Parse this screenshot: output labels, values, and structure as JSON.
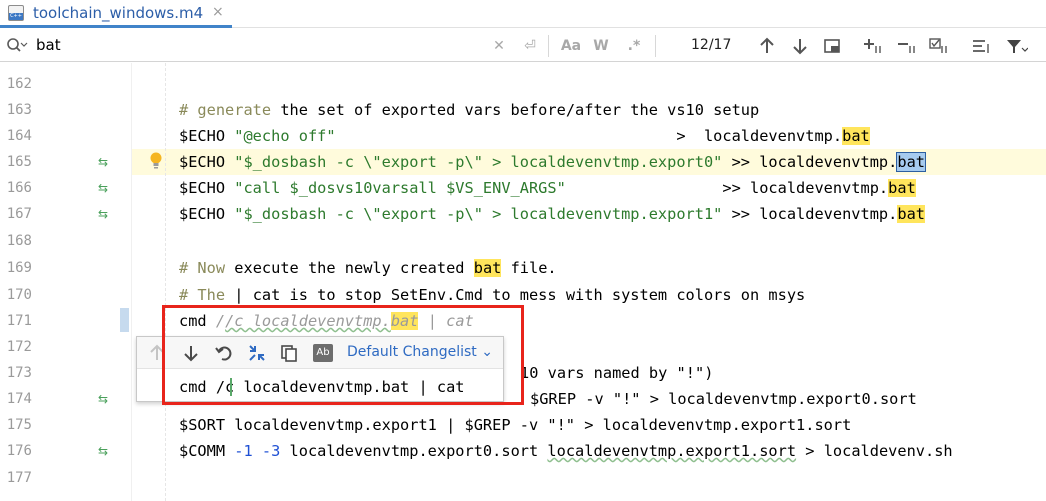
{
  "tab": {
    "title": "toolchain_windows.m4",
    "icon_label": "C++",
    "close": "×"
  },
  "search": {
    "value": "bat",
    "match_count": "12/17",
    "icons": {
      "case_label": "Aa",
      "word_label": "W",
      "regex_label": ".*"
    }
  },
  "editor": {
    "line_numbers": [
      "162",
      "163",
      "164",
      "165",
      "166",
      "167",
      "168",
      "169",
      "170",
      "171",
      "172",
      "173",
      "174",
      "175",
      "176",
      "177"
    ],
    "lines": {
      "l163_comment": "# generate",
      "l163_rest": " the set of exported vars before/after the vs10 setup",
      "l164_a": "$ECHO ",
      "l164_str": "\"@echo off\"",
      "l164_b": "                                     >  localdevenvtmp.",
      "l165_a": "$ECHO ",
      "l165_str": "\"$_dosbash -c \\\"export -p\\\" > localdevenvtmp.export0\"",
      "l165_b": " >> localdevenvtmp.",
      "l166_a": "$ECHO ",
      "l166_str": "\"call $_dosvs10varsall $VS_ENV_ARGS\"",
      "l166_b": "                 >> localdevenvtmp.",
      "l167_a": "$ECHO ",
      "l167_str": "\"$_dosbash -c \\\"export -p\\\" > localdevenvtmp.export1\"",
      "l167_b": " >> localdevenvtmp.",
      "match": "bat",
      "l169_comment": "# Now",
      "l169_a": " execute the newly created ",
      "l169_b": " file.",
      "l170_comment": "# The",
      "l170_rest": " | cat is to stop SetEnv.Cmd to mess with system colors on msys",
      "l171_a": "cmd ",
      "l171_del_a": "/",
      "l171_del_b": "/c localdevenvtmp.",
      "l171_del_c": " | cat",
      "l173_tail": "10 vars named by \"!\")",
      "l174_tail": "$GREP -v \"!\" > localdevenvtmp.export0.sort",
      "l175": "$SORT localdevenvtmp.export1 | $GREP -v \"!\" > localdevenvtmp.export1.sort",
      "l176_a": "$COMM ",
      "l176_n1": "-1",
      "l176_sp": " ",
      "l176_n2": "-3",
      "l176_b": " localdevenvtmp.export0.sort ",
      "l176_c": "localdevenvtmp.export1.sort",
      "l176_d": " > localdevenv.sh"
    }
  },
  "popup": {
    "changelist": "Default Changelist",
    "ab_label": "Ab",
    "old_line": "cmd /c localdevenvtmp.bat | cat"
  }
}
